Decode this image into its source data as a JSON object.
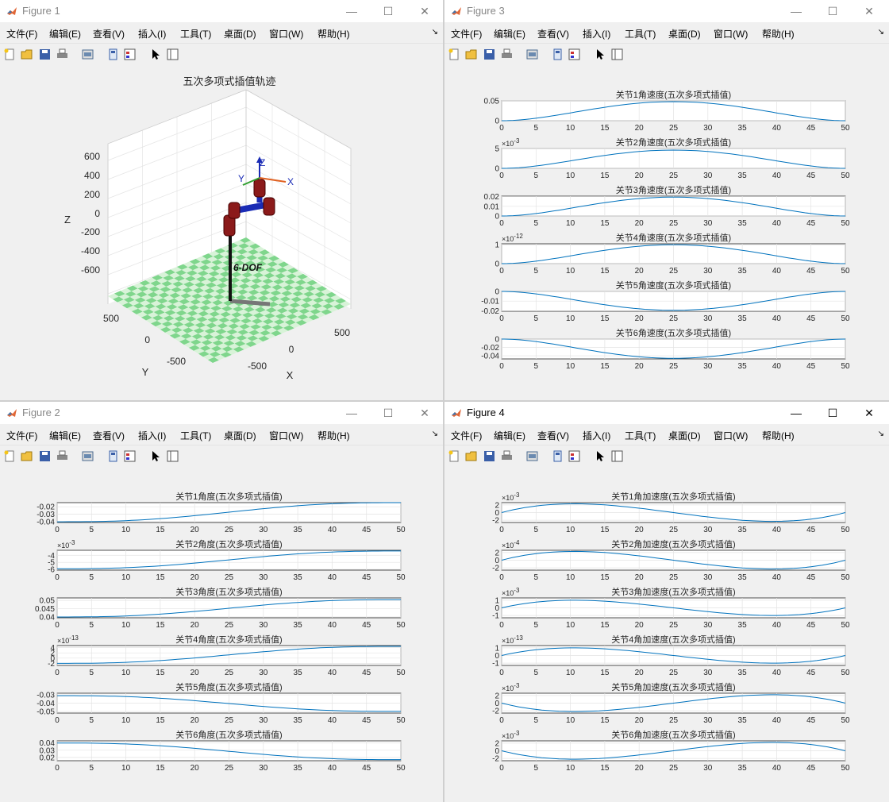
{
  "menu": [
    "文件(F)",
    "编辑(E)",
    "查看(V)",
    "插入(I)",
    "工具(T)",
    "桌面(D)",
    "窗口(W)",
    "帮助(H)"
  ],
  "windows": {
    "fig1": {
      "title": "Figure 1",
      "plot_title": "五次多项式插值轨迹",
      "robot_label": "6-DOF",
      "axis_labels": {
        "x": "X",
        "y": "Y",
        "z": "Z"
      },
      "frame_labels": {
        "x": "X",
        "y": "Y",
        "z": "Z"
      },
      "z_ticks": [
        "600",
        "400",
        "200",
        "0",
        "-200",
        "-400",
        "-600"
      ],
      "y_ticks": [
        "500",
        "0",
        "-500"
      ],
      "x_ticks": [
        "-500",
        "0",
        "500"
      ]
    },
    "fig2": {
      "title": "Figure 2"
    },
    "fig3": {
      "title": "Figure 3"
    },
    "fig4": {
      "title": "Figure 4"
    }
  },
  "chart_data": [
    {
      "figure": "Figure 2",
      "type": "line",
      "x_ticks": [
        0,
        5,
        10,
        15,
        20,
        25,
        30,
        35,
        40,
        45,
        50
      ],
      "xlim": [
        0,
        50
      ],
      "subplots": [
        {
          "title": "关节1角度(五次多项式插值)",
          "y_ticks": [
            "-0.02",
            "-0.03",
            "-0.04"
          ],
          "exponent": "",
          "ylim": [
            -0.041,
            -0.0145
          ],
          "start": -0.04,
          "end": -0.0145,
          "profile": "quintic"
        },
        {
          "title": "关节2角度(五次多项式插值)",
          "y_ticks": [
            "-4",
            "-5",
            "-6"
          ],
          "exponent": "-3",
          "ylim": [
            -6.1,
            -3.3
          ],
          "start": -5.9,
          "end": -3.4,
          "profile": "quintic"
        },
        {
          "title": "关节3角度(五次多项式插值)",
          "y_ticks": [
            "0.05",
            "0.045",
            "0.04"
          ],
          "exponent": "",
          "ylim": [
            0.0395,
            0.0515
          ],
          "start": 0.04,
          "end": 0.0505,
          "profile": "quintic"
        },
        {
          "title": "关节4角度(五次多项式插值)",
          "y_ticks": [
            "4",
            "2",
            "0",
            "-2"
          ],
          "exponent": "-13",
          "ylim": [
            -2.8,
            4.8
          ],
          "start": -2.0,
          "end": 4.5,
          "profile": "quintic"
        },
        {
          "title": "关节5角度(五次多项式插值)",
          "y_ticks": [
            "-0.03",
            "-0.04",
            "-0.05"
          ],
          "exponent": "",
          "ylim": [
            -0.052,
            -0.028
          ],
          "start": -0.031,
          "end": -0.05,
          "profile": "quintic"
        },
        {
          "title": "关节6角度(五次多项式插值)",
          "y_ticks": [
            "0.04",
            "0.03",
            "0.02"
          ],
          "exponent": "",
          "ylim": [
            0.0155,
            0.043
          ],
          "start": 0.04,
          "end": 0.017,
          "profile": "quintic"
        }
      ]
    },
    {
      "figure": "Figure 3",
      "type": "line",
      "x_ticks": [
        0,
        5,
        10,
        15,
        20,
        25,
        30,
        35,
        40,
        45,
        50
      ],
      "xlim": [
        0,
        50
      ],
      "subplots": [
        {
          "title": "关节1角速度(五次多项式插值)",
          "y_ticks": [
            "0.05",
            "0"
          ],
          "exponent": "",
          "ylim": [
            0,
            0.05
          ],
          "peak": 0.048,
          "profile": "velocity"
        },
        {
          "title": "关节2角速度(五次多项式插值)",
          "y_ticks": [
            "5",
            "0"
          ],
          "exponent": "-3",
          "ylim": [
            0,
            5
          ],
          "peak": 4.6,
          "profile": "velocity"
        },
        {
          "title": "关节3角速度(五次多项式插值)",
          "y_ticks": [
            "0.02",
            "0.01",
            "0"
          ],
          "exponent": "",
          "ylim": [
            0,
            0.0205
          ],
          "peak": 0.0195,
          "profile": "velocity"
        },
        {
          "title": "关节4角速度(五次多项式插值)",
          "y_ticks": [
            "1",
            "0"
          ],
          "exponent": "-12",
          "ylim": [
            0,
            1.05
          ],
          "peak": 1.0,
          "profile": "velocity"
        },
        {
          "title": "关节5角速度(五次多项式插值)",
          "y_ticks": [
            "0",
            "-0.01",
            "-0.02"
          ],
          "exponent": "",
          "ylim": [
            -0.0205,
            0
          ],
          "peak": -0.0195,
          "profile": "velocity"
        },
        {
          "title": "关节6角速度(五次多项式插值)",
          "y_ticks": [
            "0",
            "-0.02",
            "-0.04"
          ],
          "exponent": "",
          "ylim": [
            -0.0475,
            0
          ],
          "peak": -0.046,
          "profile": "velocity"
        }
      ]
    },
    {
      "figure": "Figure 4",
      "type": "line",
      "x_ticks": [
        0,
        5,
        10,
        15,
        20,
        25,
        30,
        35,
        40,
        45,
        50
      ],
      "xlim": [
        0,
        50
      ],
      "subplots": [
        {
          "title": "关节1角加速度(五次多项式插值)",
          "y_ticks": [
            "2",
            "0",
            "-2"
          ],
          "exponent": "-3",
          "ylim": [
            -2.6,
            2.6
          ],
          "peak": 2.3,
          "profile": "accel"
        },
        {
          "title": "关节2角加速度(五次多项式插值)",
          "y_ticks": [
            "2",
            "0",
            "-2"
          ],
          "exponent": "-4",
          "ylim": [
            -2.6,
            2.6
          ],
          "peak": 2.3,
          "profile": "accel"
        },
        {
          "title": "关节3角加速度(五次多项式插值)",
          "y_ticks": [
            "1",
            "0",
            "-1"
          ],
          "exponent": "-3",
          "ylim": [
            -1.3,
            1.3
          ],
          "peak": 1.0,
          "profile": "accel"
        },
        {
          "title": "关节4角加速度(五次多项式插值)",
          "y_ticks": [
            "1",
            "0",
            "-1"
          ],
          "exponent": "-13",
          "ylim": [
            -1.3,
            1.3
          ],
          "peak": 1.0,
          "profile": "accel"
        },
        {
          "title": "关节5角加速度(五次多项式插值)",
          "y_ticks": [
            "2",
            "0",
            "-2"
          ],
          "exponent": "-3",
          "ylim": [
            -2.6,
            2.6
          ],
          "peak": -2.2,
          "profile": "accel"
        },
        {
          "title": "关节6角加速度(五次多项式插值)",
          "y_ticks": [
            "2",
            "0",
            "-2"
          ],
          "exponent": "-3",
          "ylim": [
            -2.6,
            2.6
          ],
          "peak": -2.2,
          "profile": "accel"
        }
      ]
    }
  ]
}
